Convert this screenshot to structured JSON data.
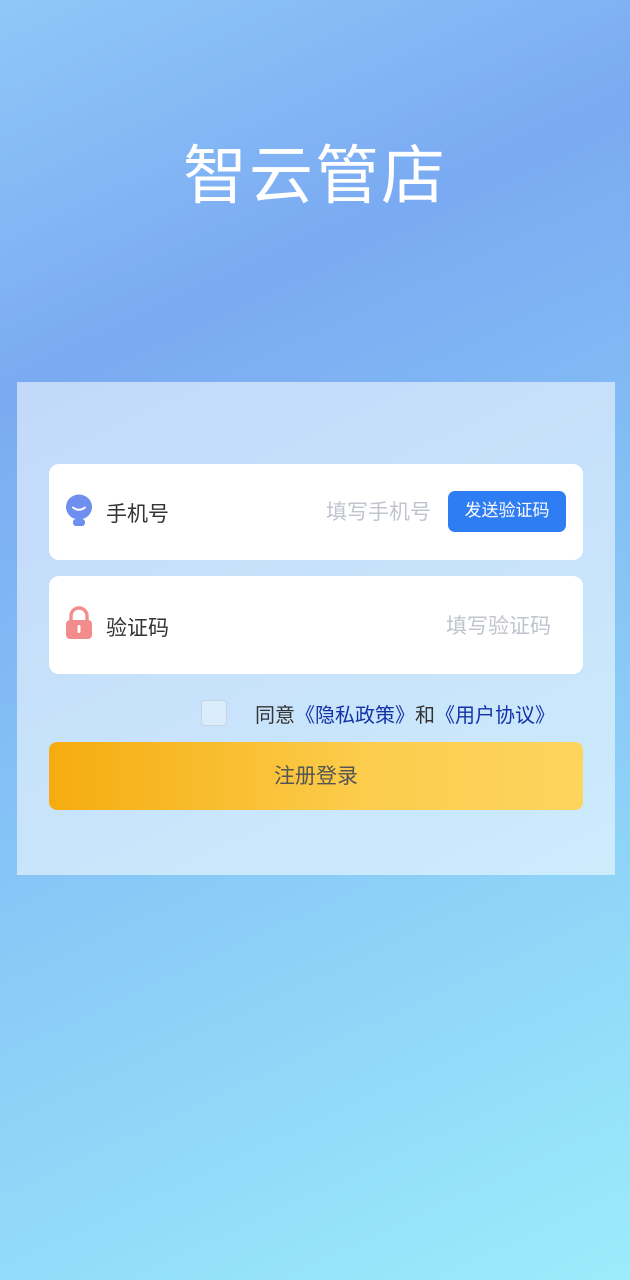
{
  "app": {
    "title": "智云管店"
  },
  "form": {
    "phone": {
      "label": "手机号",
      "placeholder": "填写手机号",
      "icon": "user-avatar-icon",
      "send_code_label": "发送验证码"
    },
    "code": {
      "label": "验证码",
      "placeholder": "填写验证码",
      "icon": "lock-icon"
    },
    "agreement": {
      "prefix": "同意",
      "privacy_link": "《隐私政策》",
      "conjunction": "和",
      "user_link": "《用户协议》",
      "checked": false
    },
    "submit_label": "注册登录"
  },
  "colors": {
    "primary_button": "#2f7df2",
    "submit_gradient_start": "#f5ac0f",
    "submit_gradient_end": "#fdd45e",
    "link": "#1432a8",
    "user_icon": "#6e8ff0",
    "lock_icon": "#f38d8d"
  }
}
